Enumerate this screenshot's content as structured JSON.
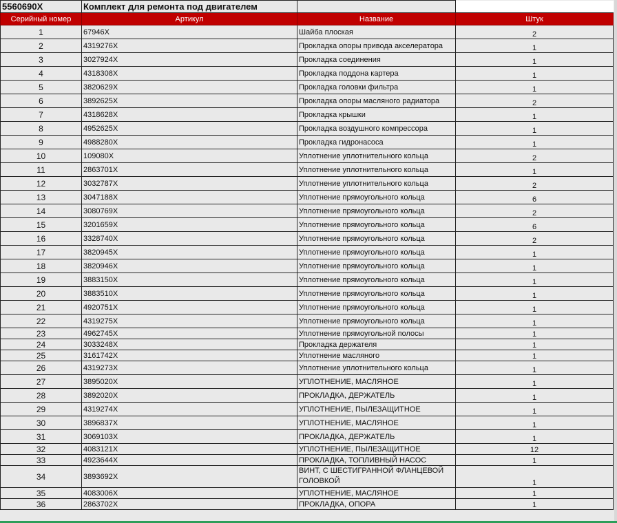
{
  "sheet": {
    "code": "5560690X",
    "title": "Комплект для ремонта под двигателем",
    "headers": [
      "Серийный номер",
      "Артикул",
      "Название",
      "Штук"
    ],
    "rows": [
      {
        "n": "1",
        "art": "67946X",
        "name": "Шайба плоская",
        "qty": "2"
      },
      {
        "n": "2",
        "art": "4319276X",
        "name": "Прокладка опоры привода акселератора",
        "qty": "1"
      },
      {
        "n": "3",
        "art": "3027924X",
        "name": "Прокладка соединения",
        "qty": "1"
      },
      {
        "n": "4",
        "art": "4318308X",
        "name": "Прокладка поддона картера",
        "qty": "1"
      },
      {
        "n": "5",
        "art": "3820629X",
        "name": "Прокладка головки фильтра",
        "qty": "1"
      },
      {
        "n": "6",
        "art": "3892625X",
        "name": "Прокладка опоры масляного радиатора",
        "qty": "2"
      },
      {
        "n": "7",
        "art": "4318628X",
        "name": "Прокладка крышки",
        "qty": "1"
      },
      {
        "n": "8",
        "art": "4952625X",
        "name": "Прокладка воздушного компрессора",
        "qty": "1"
      },
      {
        "n": "9",
        "art": "4988280X",
        "name": "Прокладка гидронасоса",
        "qty": "1"
      },
      {
        "n": "10",
        "art": "109080X",
        "name": "Уплотнение уплотнительного кольца",
        "qty": "2"
      },
      {
        "n": "11",
        "art": "2863701X",
        "name": "Уплотнение уплотнительного кольца",
        "qty": "1"
      },
      {
        "n": "12",
        "art": "3032787X",
        "name": "Уплотнение уплотнительного кольца",
        "qty": "2"
      },
      {
        "n": "13",
        "art": "3047188X",
        "name": "Уплотнение прямоугольного кольца",
        "qty": "6"
      },
      {
        "n": "14",
        "art": "3080769X",
        "name": "Уплотнение прямоугольного кольца",
        "qty": "2"
      },
      {
        "n": "15",
        "art": "3201659X",
        "name": "Уплотнение прямоугольного кольца",
        "qty": "6"
      },
      {
        "n": "16",
        "art": "3328740X",
        "name": "Уплотнение прямоугольного кольца",
        "qty": "2"
      },
      {
        "n": "17",
        "art": "3820945X",
        "name": "Уплотнение прямоугольного кольца",
        "qty": "1"
      },
      {
        "n": "18",
        "art": "3820946X",
        "name": "Уплотнение прямоугольного кольца",
        "qty": "1"
      },
      {
        "n": "19",
        "art": "3883150X",
        "name": "Уплотнение прямоугольного кольца",
        "qty": "1"
      },
      {
        "n": "20",
        "art": "3883510X",
        "name": "Уплотнение прямоугольного кольца",
        "qty": "1"
      },
      {
        "n": "21",
        "art": "4920751X",
        "name": "Уплотнение прямоугольного кольца",
        "qty": "1"
      },
      {
        "n": "22",
        "art": "4319275X",
        "name": "Уплотнение прямоугольного кольца",
        "qty": "1"
      },
      {
        "n": "23",
        "art": "4962745X",
        "name": "Уплотнение прямоугольной полосы",
        "qty": "1"
      },
      {
        "n": "24",
        "art": "3033248X",
        "name": "Прокладка держателя",
        "qty": "1"
      },
      {
        "n": "25",
        "art": "3161742X",
        "name": "Уплотнение масляного",
        "qty": "1"
      },
      {
        "n": "26",
        "art": "4319273X",
        "name": "Уплотнение уплотнительного кольца",
        "qty": "1"
      },
      {
        "n": "27",
        "art": "3895020X",
        "name": "УПЛОТНЕНИЕ, МАСЛЯНОЕ",
        "qty": "1"
      },
      {
        "n": "28",
        "art": "3892020X",
        "name": "ПРОКЛАДКА, ДЕРЖАТЕЛЬ",
        "qty": "1"
      },
      {
        "n": "29",
        "art": "4319274X",
        "name": "УПЛОТНЕНИЕ, ПЫЛЕЗАЩИТНОЕ",
        "qty": "1"
      },
      {
        "n": "30",
        "art": "3896837X",
        "name": "УПЛОТНЕНИЕ, МАСЛЯНОЕ",
        "qty": "1"
      },
      {
        "n": "31",
        "art": "3069103X",
        "name": "ПРОКЛАДКА, ДЕРЖАТЕЛЬ",
        "qty": "1"
      },
      {
        "n": "32",
        "art": "4083121X",
        "name": "УПЛОТНЕНИЕ, ПЫЛЕЗАЩИТНОЕ",
        "qty": "12"
      },
      {
        "n": "33",
        "art": "4923644X",
        "name": "ПРОКЛАДКА, ТОПЛИВНЫЙ НАСОС",
        "qty": "1"
      },
      {
        "n": "34",
        "art": "3893692X",
        "name": "ВИНТ, С ШЕСТИГРАННОЙ ФЛАНЦЕВОЙ ГОЛОВКОЙ",
        "qty": "1"
      },
      {
        "n": "35",
        "art": "4083006X",
        "name": "УПЛОТНЕНИЕ, МАСЛЯНОЕ",
        "qty": "1"
      },
      {
        "n": "36",
        "art": "2863702X",
        "name": "ПРОКЛАДКА, ОПОРА",
        "qty": "1"
      }
    ]
  }
}
